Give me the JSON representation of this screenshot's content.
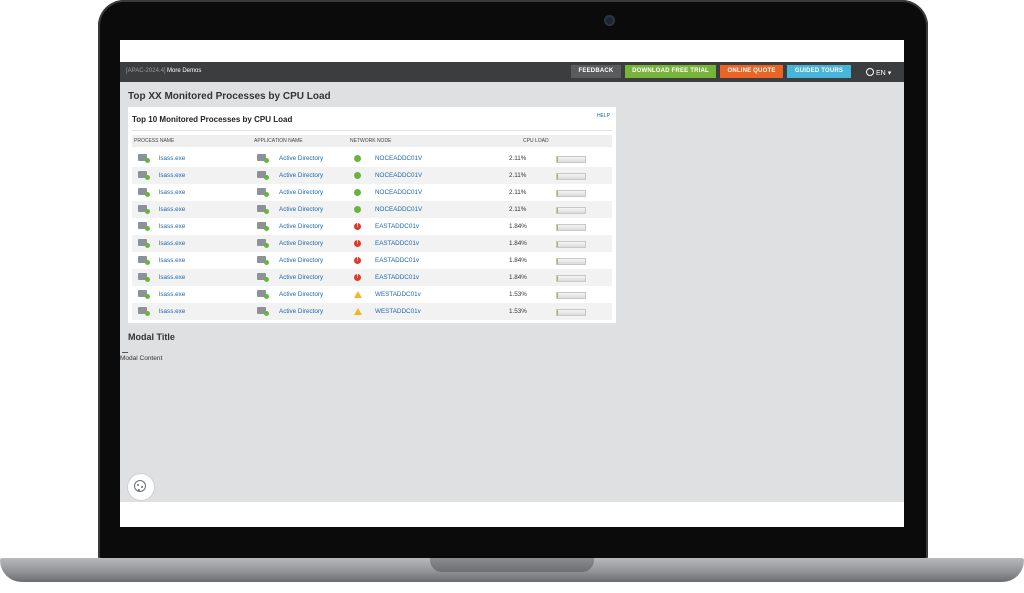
{
  "topbar": {
    "crumb": "[APAC-2024.4]",
    "more_demos": "More Demos",
    "buttons": {
      "feedback": "FEEDBACK",
      "download": "DOWNLOAD FREE TRIAL",
      "quote": "ONLINE QUOTE",
      "tours": "GUIDED TOURS"
    },
    "language": "EN",
    "colors": {
      "bar": "#3c3d3e",
      "feedback": "#5a5b5d",
      "download": "#79b43a",
      "quote": "#ea6424",
      "tours": "#47b4d9"
    }
  },
  "page": {
    "title": "Top XX Monitored Processes by CPU Load"
  },
  "widget": {
    "title": "Top 10 Monitored Processes by CPU Load",
    "help": "HELP",
    "columns": {
      "process": "PROCESS NAME",
      "application": "APPLICATION NAME",
      "node": "NETWORK NODE",
      "cpu": "CPU LOAD"
    },
    "rows": [
      {
        "process": "lsass.exe",
        "application": "Active Directory",
        "node": "NOCEADDC01V",
        "status": "up",
        "cpu": "2.11%",
        "cpu_fraction": 0.0211
      },
      {
        "process": "lsass.exe",
        "application": "Active Directory",
        "node": "NOCEADDC01V",
        "status": "up",
        "cpu": "2.11%",
        "cpu_fraction": 0.0211
      },
      {
        "process": "lsass.exe",
        "application": "Active Directory",
        "node": "NOCEADDC01V",
        "status": "up",
        "cpu": "2.11%",
        "cpu_fraction": 0.0211
      },
      {
        "process": "lsass.exe",
        "application": "Active Directory",
        "node": "NOCEADDC01V",
        "status": "up",
        "cpu": "2.11%",
        "cpu_fraction": 0.0211
      },
      {
        "process": "lsass.exe",
        "application": "Active Directory",
        "node": "EASTADDC01v",
        "status": "critical",
        "cpu": "1.84%",
        "cpu_fraction": 0.0184
      },
      {
        "process": "lsass.exe",
        "application": "Active Directory",
        "node": "EASTADDC01v",
        "status": "critical",
        "cpu": "1.84%",
        "cpu_fraction": 0.0184
      },
      {
        "process": "lsass.exe",
        "application": "Active Directory",
        "node": "EASTADDC01v",
        "status": "critical",
        "cpu": "1.84%",
        "cpu_fraction": 0.0184
      },
      {
        "process": "lsass.exe",
        "application": "Active Directory",
        "node": "EASTADDC01v",
        "status": "critical",
        "cpu": "1.84%",
        "cpu_fraction": 0.0184
      },
      {
        "process": "lsass.exe",
        "application": "Active Directory",
        "node": "WESTADDC01v",
        "status": "warning",
        "cpu": "1.53%",
        "cpu_fraction": 0.0153
      },
      {
        "process": "lsass.exe",
        "application": "Active Directory",
        "node": "WESTADDC01v",
        "status": "warning",
        "cpu": "1.53%",
        "cpu_fraction": 0.0153
      }
    ]
  },
  "modal": {
    "title": "Modal Title",
    "content": "Modal Content"
  },
  "icons": {
    "process": "process-icon",
    "application": "application-icon",
    "status_up": "status-up-icon",
    "status_critical": "status-critical-icon",
    "status_warning": "status-warning-icon",
    "cookie": "cookie-icon",
    "globe": "globe-icon"
  }
}
